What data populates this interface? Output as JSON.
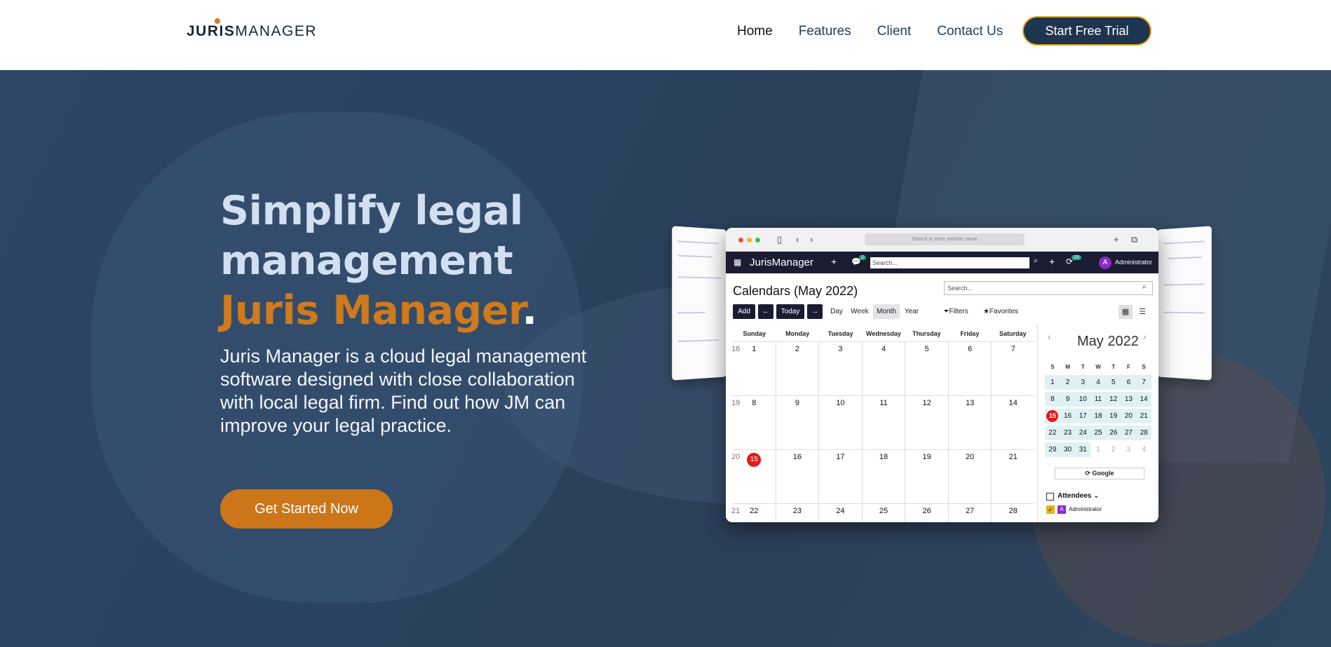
{
  "nav": {
    "logo_bold": "JURIS",
    "logo_light": "MANAGER",
    "links": [
      "Home",
      "Features",
      "Client",
      "Contact Us"
    ],
    "cta": "Start Free Trial"
  },
  "hero": {
    "title_line1": "Simplify legal",
    "title_line2": "management",
    "title_brand": "Juris Manager",
    "title_dot": ".",
    "description": "Juris Manager is a cloud legal management software designed with close collaboration with local legal firm. Find out how JM can improve your legal practice.",
    "cta": "Get Started Now"
  },
  "app": {
    "url_placeholder": "Search or enter website name",
    "brand": "JurisManager",
    "chat_badge": "2",
    "sync_badge": "23",
    "search_placeholder": "Search...",
    "avatar_letter": "A",
    "user": "Administrator",
    "calendar_title": "Calendars (May 2022)",
    "calendar_search_placeholder": "Search...",
    "toolbar": {
      "add": "Add",
      "today": "Today",
      "views": [
        "Day",
        "Week",
        "Month",
        "Year"
      ],
      "filters": "Filters",
      "favorites": "Favorites"
    },
    "weekdays": [
      "Sunday",
      "Monday",
      "Tuesday",
      "Wednesday",
      "Thursday",
      "Friday",
      "Saturday"
    ],
    "weeks": [
      {
        "num": "18",
        "days": [
          "1",
          "2",
          "3",
          "4",
          "5",
          "6",
          "7"
        ]
      },
      {
        "num": "19",
        "days": [
          "8",
          "9",
          "10",
          "11",
          "12",
          "13",
          "14"
        ]
      },
      {
        "num": "20",
        "days": [
          "15",
          "16",
          "17",
          "18",
          "19",
          "20",
          "21"
        ]
      },
      {
        "num": "21",
        "days": [
          "22",
          "23",
          "24",
          "25",
          "26",
          "27",
          "28"
        ]
      }
    ],
    "today": "15",
    "mini_calendar": {
      "title": "May 2022",
      "weekdays": [
        "S",
        "M",
        "T",
        "W",
        "T",
        "F",
        "S"
      ],
      "days": [
        "1",
        "2",
        "3",
        "4",
        "5",
        "6",
        "7",
        "8",
        "9",
        "10",
        "11",
        "12",
        "13",
        "14",
        "15",
        "16",
        "17",
        "18",
        "19",
        "20",
        "21",
        "22",
        "23",
        "24",
        "25",
        "26",
        "27",
        "28",
        "29",
        "30",
        "31",
        "1",
        "2",
        "3",
        "4"
      ],
      "outside_count": 4
    },
    "google_label": "Google",
    "attendees_label": "Attendees",
    "attendee": "Administrator"
  },
  "colors": {
    "navy": "#1e3550",
    "orange": "#cc7619",
    "today_red": "#e31b1b",
    "app_bar": "#1b1c32"
  }
}
